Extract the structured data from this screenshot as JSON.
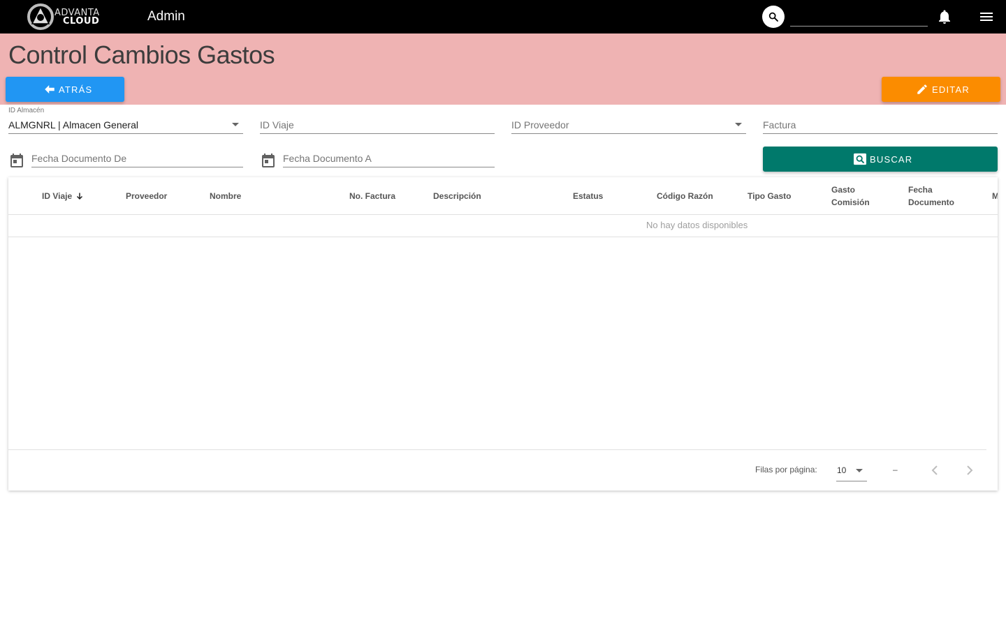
{
  "topbar": {
    "logo_line1": "ADVANTA",
    "logo_line2": "CLOUD",
    "app_title": "Admin",
    "search_placeholder": ""
  },
  "header": {
    "page_title": "Control Cambios Gastos",
    "back_label": "ATRÁS",
    "edit_label": "EDITAR",
    "band_color": "#efb3b3"
  },
  "filters": {
    "almacen": {
      "label": "ID Almacén",
      "value": "ALMGNRL | Almacen General"
    },
    "viaje": {
      "placeholder": "ID Viaje"
    },
    "proveedor": {
      "placeholder": "ID Proveedor"
    },
    "factura": {
      "placeholder": "Factura"
    },
    "fecha_de": {
      "placeholder": "Fecha Documento De"
    },
    "fecha_a": {
      "placeholder": "Fecha Documento A"
    },
    "search_label": "BUSCAR"
  },
  "table": {
    "columns": [
      {
        "line1": "ID Viaje",
        "line2": ""
      },
      {
        "line1": "Proveedor",
        "line2": ""
      },
      {
        "line1": "Nombre",
        "line2": ""
      },
      {
        "line1": "No. Factura",
        "line2": ""
      },
      {
        "line1": "Descripción",
        "line2": ""
      },
      {
        "line1": "Estatus",
        "line2": ""
      },
      {
        "line1": "Código Razón",
        "line2": ""
      },
      {
        "line1": "Tipo Gasto",
        "line2": ""
      },
      {
        "line1": "Gasto",
        "line2": "Comisión"
      },
      {
        "line1": "Fecha",
        "line2": "Documento"
      },
      {
        "line1": "M",
        "line2": ""
      }
    ],
    "empty_text": "No hay datos disponibles",
    "rows_per_page_label": "Filas por página:",
    "rows_per_page": "10",
    "range": "–"
  },
  "colors": {
    "back": "#2196f3",
    "edit": "#fb8c00",
    "search": "#00796b"
  }
}
